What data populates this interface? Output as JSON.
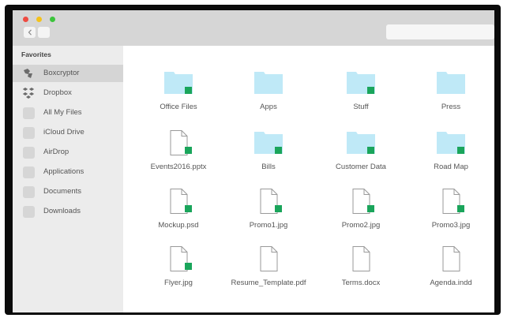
{
  "window": {
    "traffic_lights": {
      "close": "#ee4b41",
      "minimize": "#f4c21a",
      "zoom": "#3cc43c"
    }
  },
  "toolbar": {
    "back_icon": "chevron-left-icon",
    "forward_icon": "chevron-right-icon",
    "search_placeholder": ""
  },
  "sidebar": {
    "heading": "Favorites",
    "items": [
      {
        "label": "Boxcryptor",
        "icon": "boxcryptor-icon",
        "selected": true
      },
      {
        "label": "Dropbox",
        "icon": "dropbox-icon"
      },
      {
        "label": "All My Files",
        "icon": "placeholder-icon"
      },
      {
        "label": "iCloud Drive",
        "icon": "placeholder-icon"
      },
      {
        "label": "AirDrop",
        "icon": "placeholder-icon"
      },
      {
        "label": "Applications",
        "icon": "placeholder-icon"
      },
      {
        "label": "Documents",
        "icon": "placeholder-icon"
      },
      {
        "label": "Downloads",
        "icon": "placeholder-icon"
      }
    ]
  },
  "files": [
    {
      "name": "Office Files",
      "kind": "folder",
      "encrypted": true
    },
    {
      "name": "Apps",
      "kind": "folder",
      "encrypted": false
    },
    {
      "name": "Stuff",
      "kind": "folder",
      "encrypted": true
    },
    {
      "name": "Press",
      "kind": "folder",
      "encrypted": false
    },
    {
      "name": "Events2016.pptx",
      "kind": "file",
      "encrypted": true
    },
    {
      "name": "Bills",
      "kind": "folder",
      "encrypted": true
    },
    {
      "name": "Customer Data",
      "kind": "folder",
      "encrypted": true
    },
    {
      "name": "Road Map",
      "kind": "folder",
      "encrypted": true
    },
    {
      "name": "Mockup.psd",
      "kind": "file",
      "encrypted": true
    },
    {
      "name": "Promo1.jpg",
      "kind": "file",
      "encrypted": true
    },
    {
      "name": "Promo2.jpg",
      "kind": "file",
      "encrypted": true
    },
    {
      "name": "Promo3.jpg",
      "kind": "file",
      "encrypted": true
    },
    {
      "name": "Flyer.jpg",
      "kind": "file",
      "encrypted": true
    },
    {
      "name": "Resume_Template.pdf",
      "kind": "file",
      "encrypted": false
    },
    {
      "name": "Terms.docx",
      "kind": "file",
      "encrypted": false
    },
    {
      "name": "Agenda.indd",
      "kind": "file",
      "encrypted": false
    }
  ],
  "colors": {
    "folder": "#bfe9f7",
    "encrypted_badge": "#1aa55b",
    "sidebar_bg": "#ececec",
    "sidebar_selected": "#d5d5d5"
  }
}
